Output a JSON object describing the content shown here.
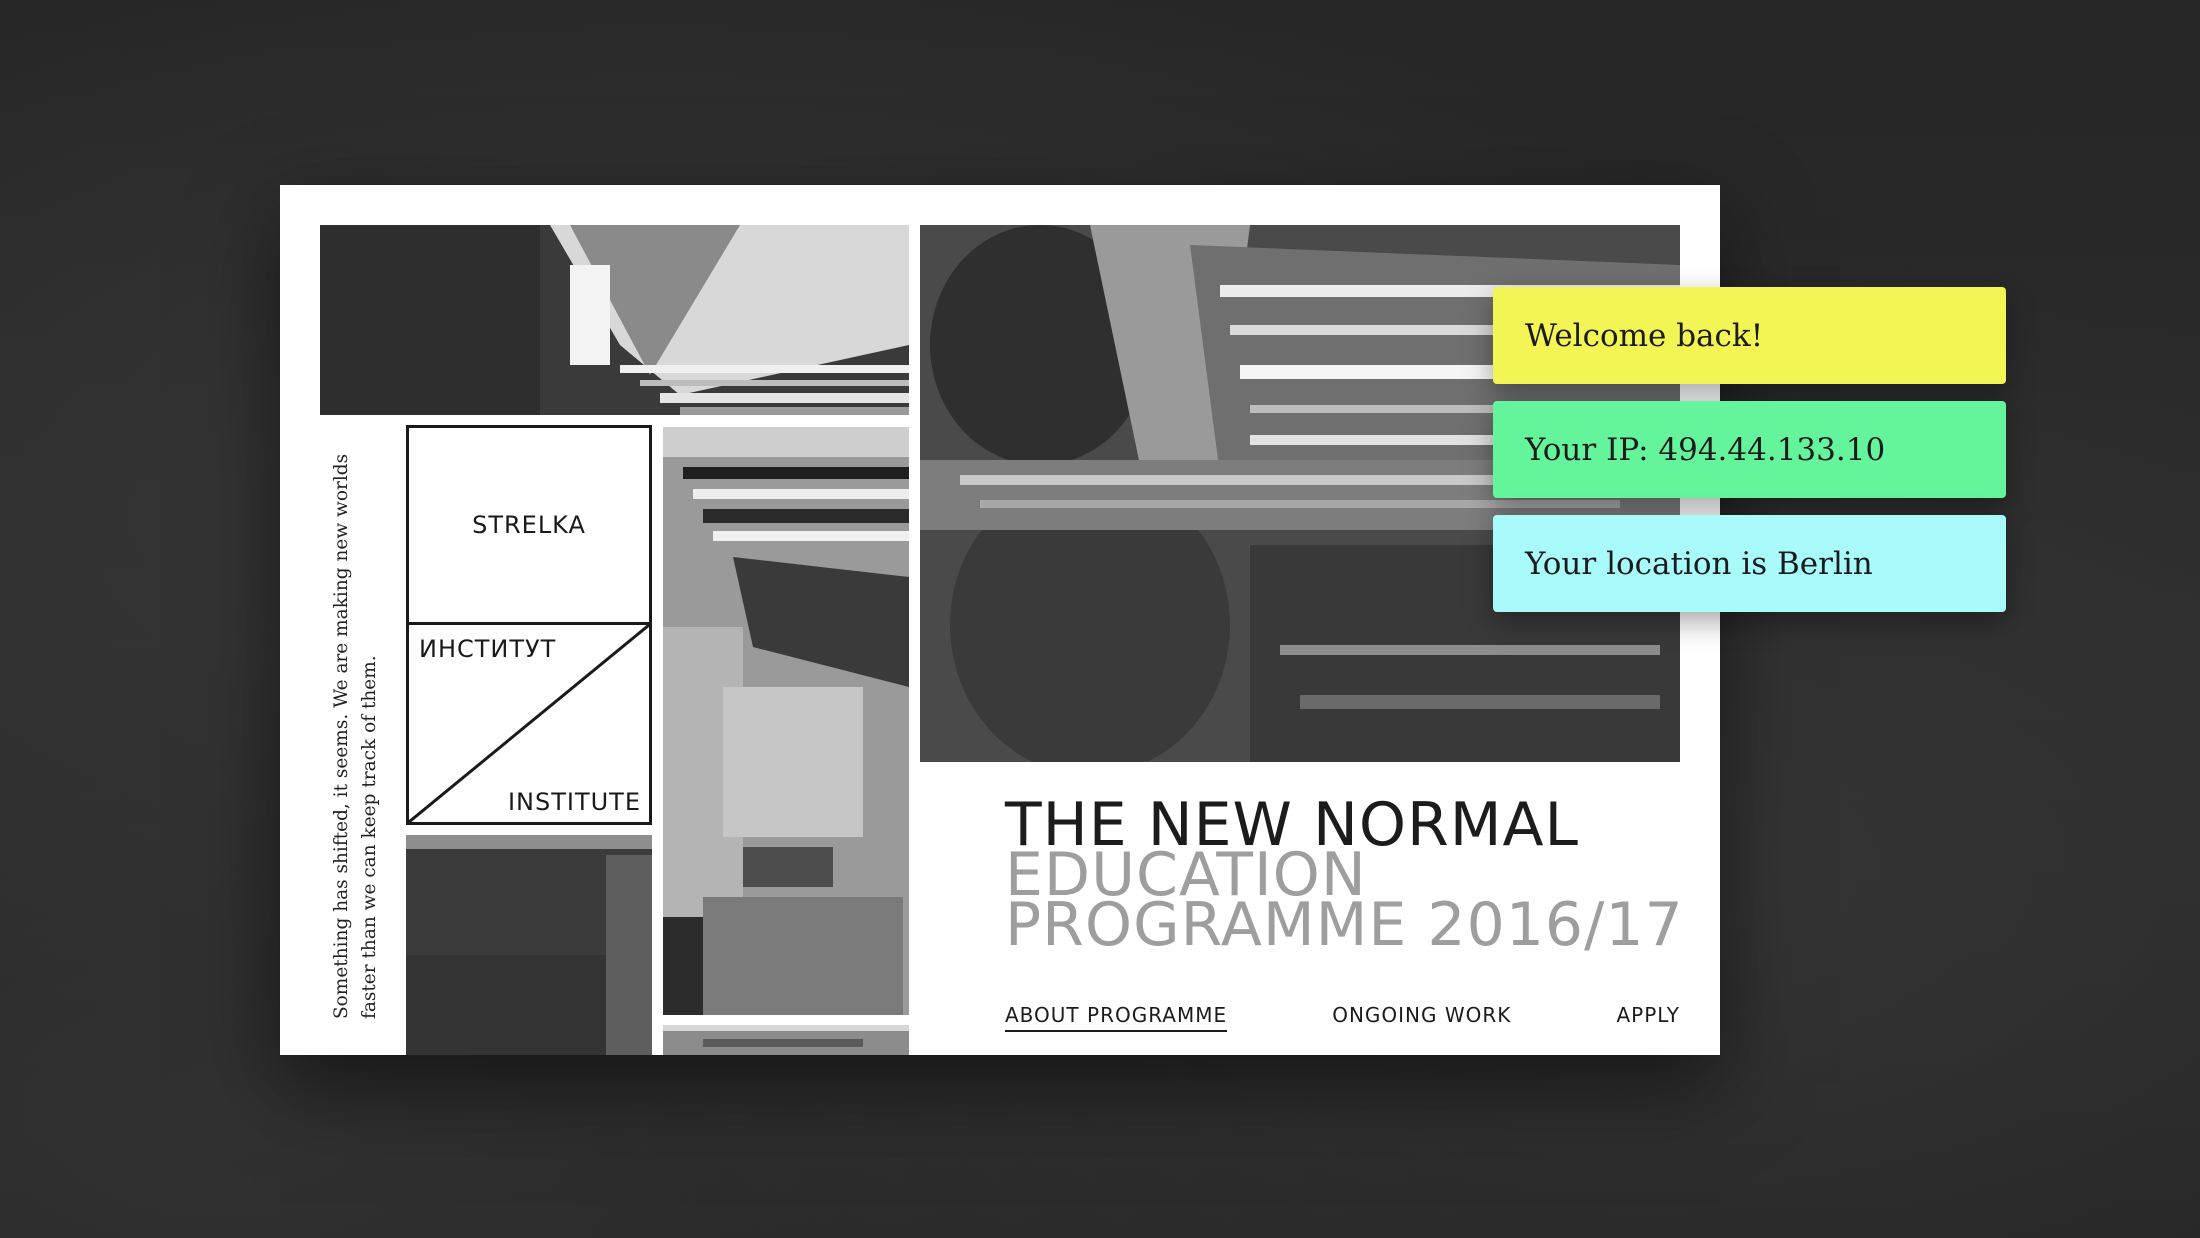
{
  "tagline": "Something has shifted, it seems. We are making new worlds faster than we can keep track of them.",
  "logo": {
    "top": "STRELKA",
    "ru": "ИНСТИТУТ",
    "en": "INSTITUTE"
  },
  "hero": {
    "line1": "THE NEW NORMAL",
    "line2": "EDUCATION",
    "line3": "PROGRAMME 2016/17"
  },
  "nav": {
    "about": "ABOUT PROGRAMME",
    "ongoing": "ONGOING WORK",
    "apply": "APPLY"
  },
  "notifications": {
    "welcome": "Welcome back!",
    "ip": "Your IP: 494.44.133.10",
    "location": "Your location is Berlin"
  },
  "colors": {
    "welcome_bg": "#f2f553",
    "ip_bg": "#64f59c",
    "location_bg": "#a8fbfa",
    "page_bg": "#ffffff",
    "backdrop": "#2a2a2a"
  }
}
